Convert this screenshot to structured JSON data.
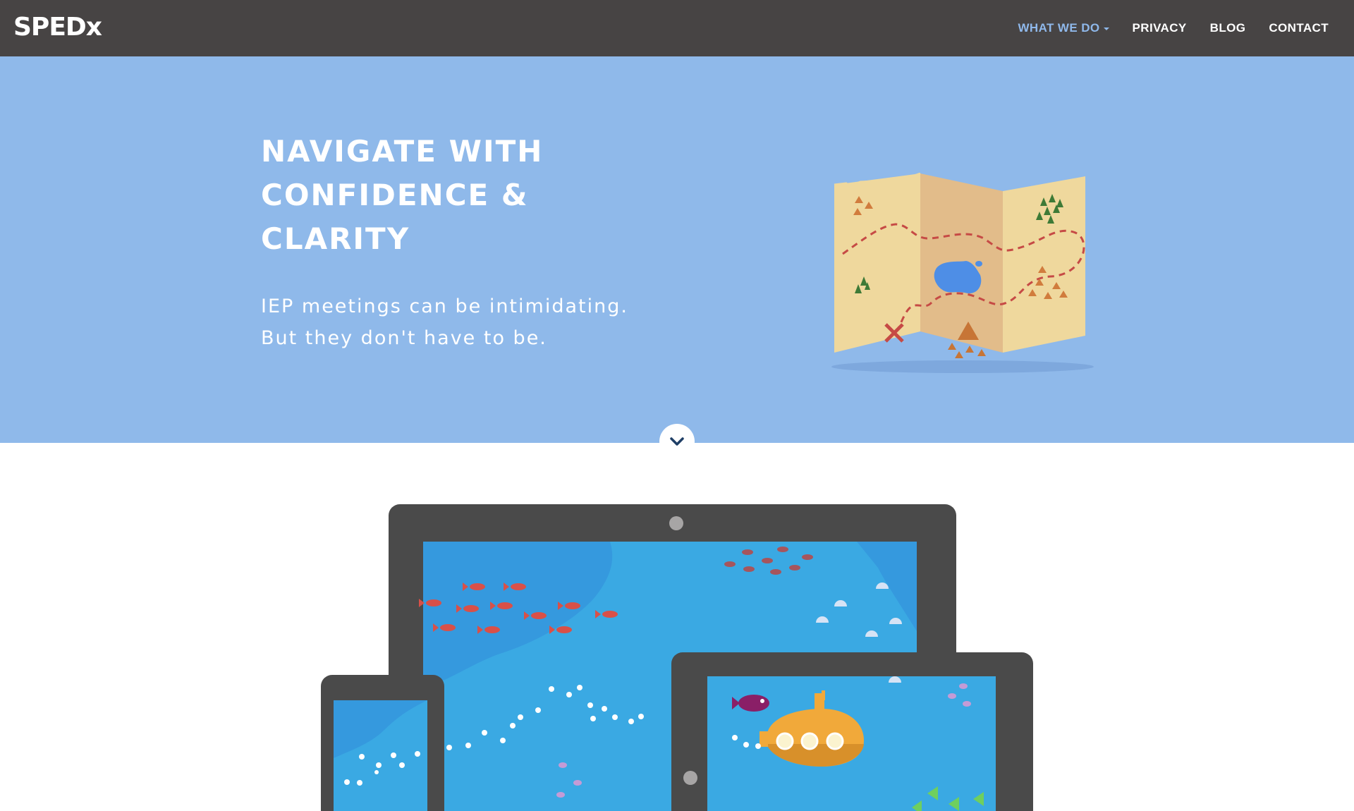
{
  "navbar": {
    "brand": "SPEDx",
    "links": [
      {
        "label": "WHAT WE DO",
        "active": true,
        "has_dropdown": true
      },
      {
        "label": "PRIVACY",
        "active": false
      },
      {
        "label": "BLOG",
        "active": false
      },
      {
        "label": "CONTACT",
        "active": false
      }
    ]
  },
  "hero": {
    "title": "NAVIGATE WITH CONFIDENCE & CLARITY",
    "subtitle_line1": "IEP meetings can be intimidating.",
    "subtitle_line2": "But they don't have to be.",
    "illustration": "treasure-map-icon",
    "scroll_icon": "chevron-down-icon"
  },
  "showcase": {
    "illustration": "devices-ocean-illustration"
  },
  "colors": {
    "navbar_bg": "#474444",
    "hero_bg": "#8fb9ea",
    "active_link": "#8fb8ea",
    "device_frame": "#4a4a4a",
    "ocean": "#3aa9e3",
    "submarine": "#f1a93a"
  }
}
